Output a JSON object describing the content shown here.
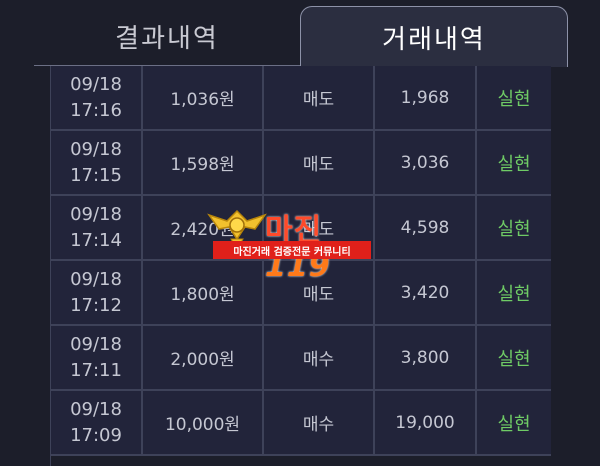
{
  "tabs": {
    "results_label": "결과내역",
    "trades_label": "거래내역"
  },
  "rows": [
    {
      "date": "09/18",
      "time": "17:16",
      "amount": "1,036원",
      "type": "매도",
      "price": "1,968",
      "status": "실현"
    },
    {
      "date": "09/18",
      "time": "17:15",
      "amount": "1,598원",
      "type": "매도",
      "price": "3,036",
      "status": "실현"
    },
    {
      "date": "09/18",
      "time": "17:14",
      "amount": "2,420원",
      "type": "매도",
      "price": "4,598",
      "status": "실현"
    },
    {
      "date": "09/18",
      "time": "17:12",
      "amount": "1,800원",
      "type": "매도",
      "price": "3,420",
      "status": "실현"
    },
    {
      "date": "09/18",
      "time": "17:11",
      "amount": "2,000원",
      "type": "매수",
      "price": "3,800",
      "status": "실현"
    },
    {
      "date": "09/18",
      "time": "17:09",
      "amount": "10,000원",
      "type": "매수",
      "price": "19,000",
      "status": "실현"
    }
  ],
  "watermark": {
    "title_main": "마진",
    "title_num": "119",
    "banner": "마진거래 검증전문 커뮤니티"
  },
  "colors": {
    "background": "#1c1e2a",
    "row_bg": "#22243a",
    "grid": "#3e4259",
    "status_green": "#6fcb65",
    "watermark_red": "#e0201a"
  }
}
